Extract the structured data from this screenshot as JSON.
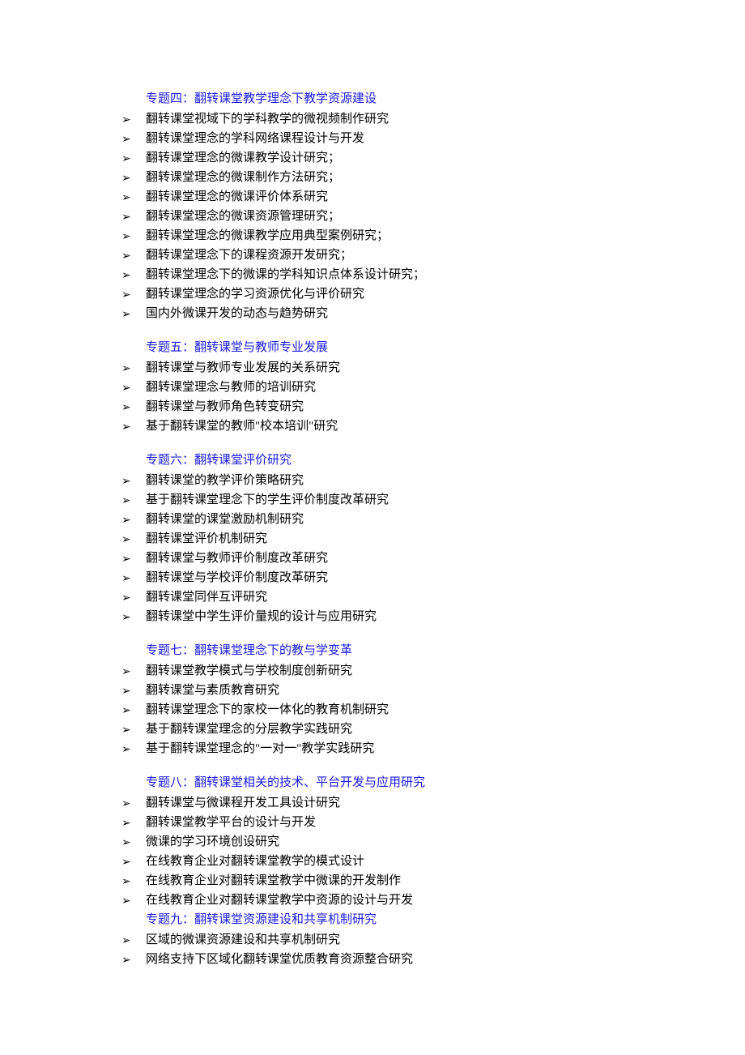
{
  "sections": [
    {
      "title": "专题四：翻转课堂教学理念下教学资源建设",
      "items": [
        "翻转课堂视域下的学科教学的微视频制作研究",
        "翻转课堂理念的学科网络课程设计与开发",
        "翻转课堂理念的微课教学设计研究；",
        "翻转课堂理念的微课制作方法研究；",
        "翻转课堂理念的微课评价体系研究",
        "翻转课堂理念的微课资源管理研究；",
        "翻转课堂理念的微课教学应用典型案例研究；",
        "翻转课堂理念下的课程资源开发研究；",
        "翻转课堂理念下的微课的学科知识点体系设计研究；",
        "翻转课堂理念的学习资源优化与评价研究",
        "国内外微课开发的动态与趋势研究"
      ]
    },
    {
      "title": "专题五：翻转课堂与教师专业发展",
      "items": [
        "翻转课堂与教师专业发展的关系研究",
        "翻转课堂理念与教师的培训研究",
        "翻转课堂与教师角色转变研究",
        "基于翻转课堂的教师\"校本培训\"研究"
      ]
    },
    {
      "title": "专题六：翻转课堂评价研究",
      "items": [
        "翻转课堂的教学评价策略研究",
        "基于翻转课堂理念下的学生评价制度改革研究",
        "翻转课堂的课堂激励机制研究",
        "翻转课堂评价机制研究",
        "翻转课堂与教师评价制度改革研究",
        "翻转课堂与学校评价制度改革研究",
        "翻转课堂同伴互评研究",
        "翻转课堂中学生评价量规的设计与应用研究"
      ]
    },
    {
      "title": "专题七：翻转课堂理念下的教与学变革",
      "items": [
        "翻转课堂教学模式与学校制度创新研究",
        "翻转课堂与素质教育研究",
        "翻转课堂理念下的家校一体化的教育机制研究",
        "基于翻转课堂理念的分层教学实践研究",
        "基于翻转课堂理念的\"一对一\"教学实践研究"
      ]
    },
    {
      "title": "专题八：翻转课堂相关的技术、平台开发与应用研究",
      "items": [
        "翻转课堂与微课程开发工具设计研究",
        "翻转课堂教学平台的设计与开发",
        "微课的学习环境创设研究",
        "在线教育企业对翻转课堂教学的模式设计",
        "在线教育企业对翻转课堂教学中微课的开发制作",
        "在线教育企业对翻转课堂教学中资源的设计与开发"
      ]
    },
    {
      "title": "专题九：翻转课堂资源建设和共享机制研究",
      "items": [
        "区域的微课资源建设和共享机制研究",
        "网络支持下区域化翻转课堂优质教育资源整合研究"
      ]
    }
  ]
}
